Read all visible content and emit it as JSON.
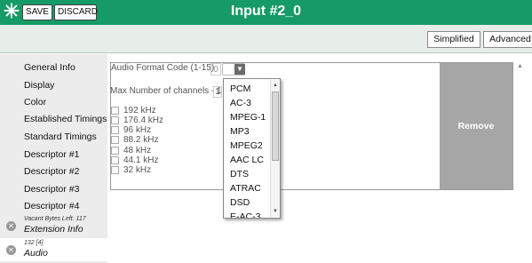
{
  "titlebar": {
    "title": "Input #2_0",
    "save_label": "SAVE",
    "discard_label": "DISCARD",
    "color": "#169a67"
  },
  "modes": {
    "simplified": "Simplified",
    "advanced": "Advanced"
  },
  "sidebar": {
    "items": [
      "General Info",
      "Display",
      "Color",
      "Established Timings",
      "Standard Timings",
      "Descriptor #1",
      "Descriptor #2",
      "Descriptor #3",
      "Descriptor #4"
    ],
    "extension": {
      "small": "Vacant Bytes Left: 117",
      "label": "Extension Info"
    },
    "audio": {
      "small": "132 [4]",
      "label": "Audio"
    }
  },
  "form": {
    "code_label": "Audio Format Code (1-15)",
    "code_value": "0",
    "channels_label": "Max Number of channels - 1",
    "channels_value": "1",
    "sample_rates": [
      "192 kHz",
      "176.4 kHz",
      "96 kHz",
      "88.2 kHz",
      "48 kHz",
      "44.1 kHz",
      "32 kHz"
    ],
    "remove_label": "Remove"
  },
  "dropdown": {
    "options": [
      "PCM",
      "AC-3",
      "MPEG-1",
      "MP3",
      "MPEG2",
      "AAC LC",
      "DTS",
      "ATRAC",
      "DSD",
      "E-AC-3"
    ]
  }
}
